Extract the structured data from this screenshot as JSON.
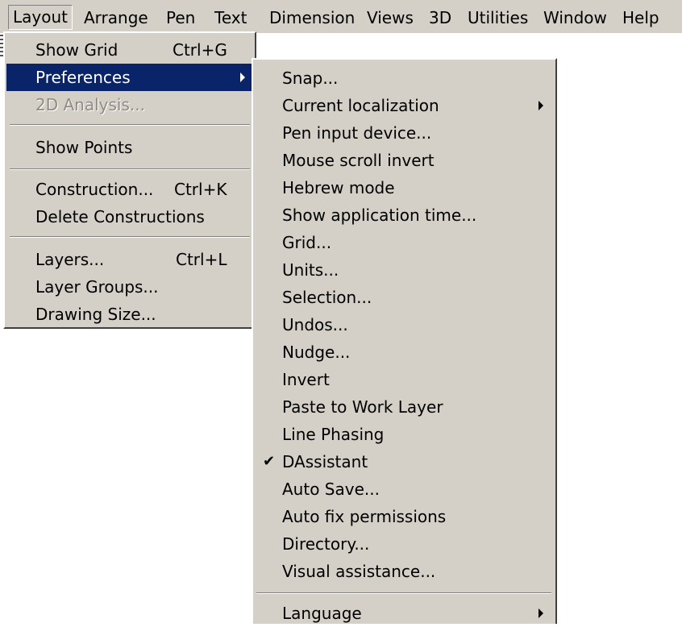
{
  "menubar": {
    "items": [
      {
        "label": "Layout"
      },
      {
        "label": "Arrange"
      },
      {
        "label": "Pen"
      },
      {
        "label": "Text"
      },
      {
        "label": "Dimension"
      },
      {
        "label": "Views"
      },
      {
        "label": "3D"
      },
      {
        "label": "Utilities"
      },
      {
        "label": "Window"
      },
      {
        "label": "Help"
      }
    ]
  },
  "layout_menu": {
    "items": [
      {
        "label": "Show Grid",
        "shortcut": "Ctrl+G"
      },
      {
        "label": "Preferences"
      },
      {
        "label": "2D Analysis..."
      },
      {
        "label": "Show Points"
      },
      {
        "label": "Construction...",
        "shortcut": "Ctrl+K"
      },
      {
        "label": "Delete Constructions"
      },
      {
        "label": "Layers...",
        "shortcut": "Ctrl+L"
      },
      {
        "label": "Layer Groups..."
      },
      {
        "label": "Drawing Size..."
      }
    ]
  },
  "preferences_menu": {
    "items": [
      {
        "label": "Snap..."
      },
      {
        "label": "Current localization"
      },
      {
        "label": "Pen input device..."
      },
      {
        "label": "Mouse scroll invert"
      },
      {
        "label": "Hebrew mode"
      },
      {
        "label": "Show application time..."
      },
      {
        "label": "Grid..."
      },
      {
        "label": "Units..."
      },
      {
        "label": "Selection..."
      },
      {
        "label": "Undos..."
      },
      {
        "label": "Nudge..."
      },
      {
        "label": "Invert"
      },
      {
        "label": "Paste to Work Layer"
      },
      {
        "label": "Line Phasing"
      },
      {
        "label": "DAssistant",
        "checked": true
      },
      {
        "label": "Auto Save..."
      },
      {
        "label": "Auto fix permissions"
      },
      {
        "label": "Directory..."
      },
      {
        "label": "Visual assistance..."
      },
      {
        "label": "Language"
      }
    ],
    "checkmark": "✔"
  },
  "colors": {
    "menu_bg": "#d4d0c8",
    "highlight": "#0a246a",
    "disabled_text": "#8f8b84"
  }
}
